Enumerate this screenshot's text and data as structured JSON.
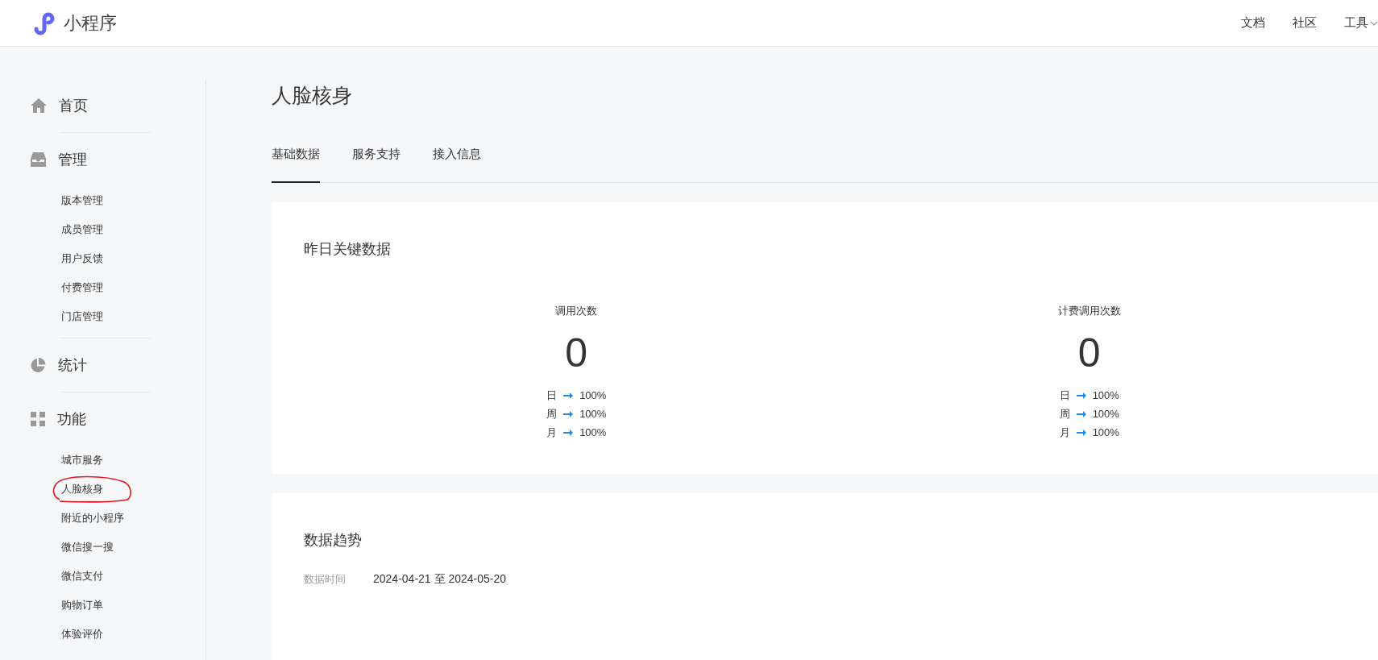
{
  "header": {
    "logo_text": "小程序",
    "nav": [
      {
        "label": "文档",
        "kind": "link"
      },
      {
        "label": "社区",
        "kind": "link"
      },
      {
        "label": "工具",
        "kind": "dropdown"
      }
    ]
  },
  "sidebar": {
    "sections": [
      {
        "label": "首页"
      },
      {
        "label": "管理",
        "items": [
          {
            "label": "版本管理",
            "annotated": false
          },
          {
            "label": "成员管理",
            "annotated": false
          },
          {
            "label": "用户反馈",
            "annotated": false
          },
          {
            "label": "付费管理",
            "annotated": false
          },
          {
            "label": "门店管理",
            "annotated": false
          }
        ]
      },
      {
        "label": "统计"
      },
      {
        "label": "功能",
        "items": [
          {
            "label": "城市服务",
            "annotated": false
          },
          {
            "label": "人脸核身",
            "annotated": true
          },
          {
            "label": "附近的小程序",
            "annotated": false
          },
          {
            "label": "微信搜一搜",
            "annotated": false
          },
          {
            "label": "微信支付",
            "annotated": false
          },
          {
            "label": "购物订单",
            "annotated": false
          },
          {
            "label": "体验评价",
            "annotated": false
          }
        ]
      }
    ]
  },
  "page_title": "人脸核身",
  "tabs": [
    {
      "label": "基础数据",
      "selected": true
    },
    {
      "label": "服务支持",
      "selected": false
    },
    {
      "label": "接入信息",
      "selected": false
    }
  ],
  "key_data": {
    "title": "昨日关键数据",
    "stats": [
      {
        "label": "调用次数",
        "value": "0",
        "changes": [
          {
            "period": "日",
            "value": "100%"
          },
          {
            "period": "周",
            "value": "100%"
          },
          {
            "period": "月",
            "value": "100%"
          }
        ]
      },
      {
        "label": "计费调用次数",
        "value": "0",
        "changes": [
          {
            "period": "日",
            "value": "100%"
          },
          {
            "period": "周",
            "value": "100%"
          },
          {
            "period": "月",
            "value": "100%"
          }
        ]
      }
    ]
  },
  "trend": {
    "title": "数据趋势",
    "date_label": "数据时间",
    "date_range": "2024-04-21 至 2024-05-20"
  }
}
